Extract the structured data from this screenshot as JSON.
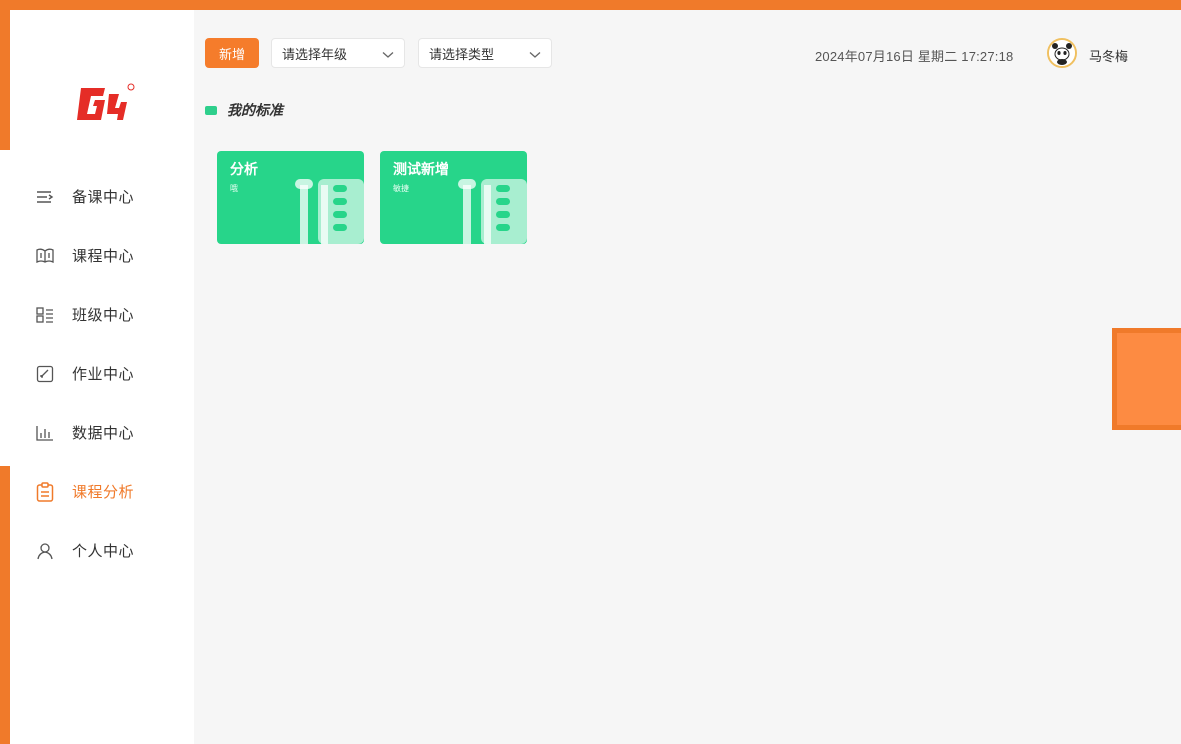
{
  "toolbar": {
    "add_label": "新增",
    "grade_placeholder": "请选择年级",
    "type_placeholder": "请选择类型"
  },
  "header": {
    "datetime": "2024年07月16日  星期二  17:27:18",
    "username": "马冬梅"
  },
  "sidebar": {
    "items": [
      {
        "label": "备课中心",
        "icon": "list-indent-icon",
        "active": false
      },
      {
        "label": "课程中心",
        "icon": "book-open-icon",
        "active": false
      },
      {
        "label": "班级中心",
        "icon": "class-grid-icon",
        "active": false
      },
      {
        "label": "作业中心",
        "icon": "edit-square-icon",
        "active": false
      },
      {
        "label": "数据中心",
        "icon": "bar-chart-icon",
        "active": false
      },
      {
        "label": "课程分析",
        "icon": "clipboard-icon",
        "active": true
      },
      {
        "label": "个人中心",
        "icon": "user-icon",
        "active": false
      }
    ]
  },
  "main": {
    "section_title": "我的标准",
    "cards": [
      {
        "title": "分析",
        "subtitle": "哦"
      },
      {
        "title": "测试新增",
        "subtitle": "敏捷"
      }
    ]
  },
  "colors": {
    "accent": "#f07a2a",
    "card_green": "#27d58a",
    "section_mark": "#2ecf8c"
  }
}
